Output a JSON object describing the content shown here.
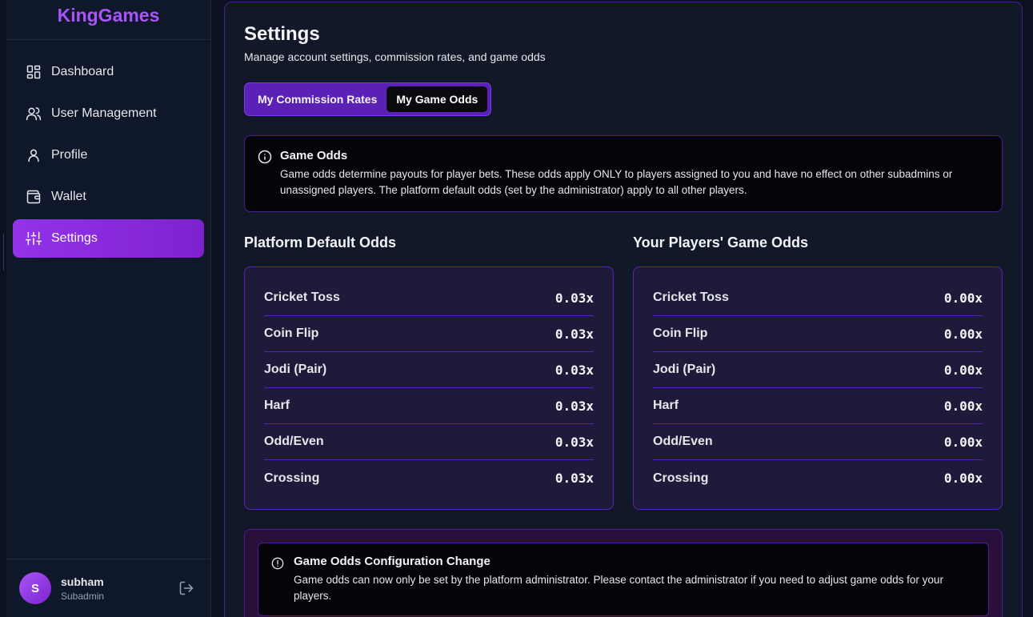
{
  "brand": "KingGames",
  "nav": [
    {
      "label": "Dashboard",
      "icon": "dashboard-icon"
    },
    {
      "label": "User Management",
      "icon": "users-icon"
    },
    {
      "label": "Profile",
      "icon": "user-icon"
    },
    {
      "label": "Wallet",
      "icon": "wallet-icon"
    },
    {
      "label": "Settings",
      "icon": "sliders-icon",
      "active": true
    }
  ],
  "user": {
    "initial": "S",
    "name": "subham",
    "role": "Subadmin"
  },
  "page": {
    "title": "Settings",
    "subtitle": "Manage account settings, commission rates, and game odds"
  },
  "tabs": [
    {
      "label": "My Commission Rates",
      "active": false
    },
    {
      "label": "My Game Odds",
      "active": true
    }
  ],
  "info": {
    "title": "Game Odds",
    "text": "Game odds determine payouts for player bets. These odds apply ONLY to players assigned to you and have no effect on other subadmins or unassigned players. The platform default odds (set by the administrator) apply to all other players."
  },
  "platform_odds": {
    "title": "Platform Default Odds",
    "rows": [
      {
        "name": "Cricket Toss",
        "value": "0.03x"
      },
      {
        "name": "Coin Flip",
        "value": "0.03x"
      },
      {
        "name": "Jodi (Pair)",
        "value": "0.03x"
      },
      {
        "name": "Harf",
        "value": "0.03x"
      },
      {
        "name": "Odd/Even",
        "value": "0.03x"
      },
      {
        "name": "Crossing",
        "value": "0.03x"
      }
    ]
  },
  "player_odds": {
    "title": "Your Players' Game Odds",
    "rows": [
      {
        "name": "Cricket Toss",
        "value": "0.00x"
      },
      {
        "name": "Coin Flip",
        "value": "0.00x"
      },
      {
        "name": "Jodi (Pair)",
        "value": "0.00x"
      },
      {
        "name": "Harf",
        "value": "0.00x"
      },
      {
        "name": "Odd/Even",
        "value": "0.00x"
      },
      {
        "name": "Crossing",
        "value": "0.00x"
      }
    ]
  },
  "notice": {
    "title": "Game Odds Configuration Change",
    "text": "Game odds can now only be set by the platform administrator. Please contact the administrator if you need to adjust game odds for your players."
  },
  "colors": {
    "accent": "#a855f7",
    "active_nav": "#9333ea",
    "background": "#0b1120",
    "card": "#1e1b3a"
  }
}
